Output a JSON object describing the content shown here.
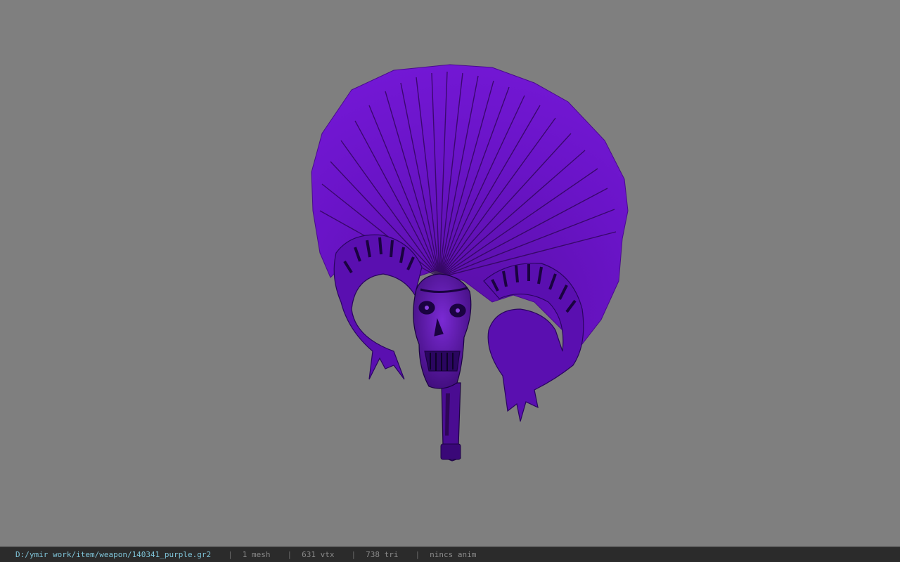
{
  "viewer": {
    "background_color": "#7f7f7f",
    "model_name": "purple skull fan weapon",
    "model_color": "#6a12c4"
  },
  "statusbar": {
    "path": "D:/ymir work/item/weapon/140341_purple.gr2",
    "separator": "|",
    "mesh": "1 mesh",
    "vtx": "631 vtx",
    "tri": "738 tri",
    "anim": "nincs anim"
  }
}
